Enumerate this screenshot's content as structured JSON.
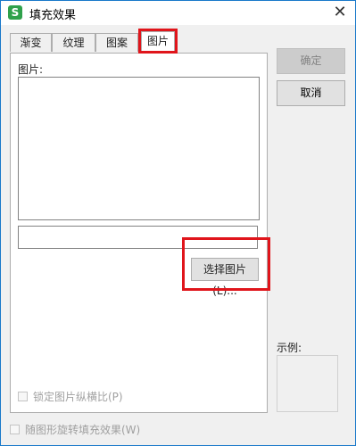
{
  "window": {
    "title": "填充效果",
    "app_icon_glyph": "S",
    "close_glyph": "✕"
  },
  "tabs": [
    {
      "label": "渐变",
      "active": false
    },
    {
      "label": "纹理",
      "active": false
    },
    {
      "label": "图案",
      "active": false
    },
    {
      "label": "图片",
      "active": true
    }
  ],
  "picture_panel": {
    "label": "图片:",
    "path_value": "",
    "select_button_label": "选择图片(L)...",
    "lock_aspect_label": "锁定图片纵横比(P)"
  },
  "buttons": {
    "ok_label": "确定",
    "cancel_label": "取消"
  },
  "sample": {
    "label": "示例:"
  },
  "rotate_label": "随图形旋转填充效果(W)",
  "colors": {
    "highlight": "#e0151b",
    "app_icon": "#2fa14b",
    "window_border": "#1979ca"
  }
}
